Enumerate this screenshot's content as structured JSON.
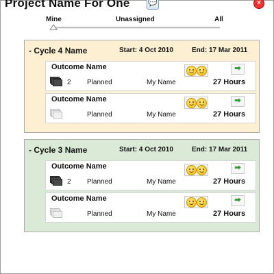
{
  "header": {
    "project_title": "Project Name For One",
    "title_icon": "speech-bubble-icon",
    "close_icon": "close-icon"
  },
  "filter": {
    "options": [
      "Mine",
      "Unassigned",
      "All"
    ],
    "selected": "Mine"
  },
  "cycles": [
    {
      "name": "- Cycle 4 Name",
      "start": "Start: 4 Oct 2010",
      "end": "End: 17 Mar 2011",
      "background": "#fdf0d2",
      "outcomes": [
        {
          "name": "Outcome Name",
          "count": "2",
          "status": "Planned",
          "owner": "My Name",
          "hours": "27 Hours",
          "icon": "dark-stack-icon"
        },
        {
          "name": "Outcome Name",
          "count": "",
          "status": "Planned",
          "owner": "My Name",
          "hours": "27 Hours",
          "icon": "light-stack-icon"
        }
      ]
    },
    {
      "name": "- Cycle 3 Name",
      "start": "Start: 4 Oct 2010",
      "end": "End: 17 Mar 2011",
      "background": "#dbead6",
      "outcomes": [
        {
          "name": "Outcome Name",
          "count": "2",
          "status": "Planned",
          "owner": "My Name",
          "hours": "27 Hours",
          "icon": "dark-stack-icon"
        },
        {
          "name": "Outcome Name",
          "count": "",
          "status": "Planned",
          "owner": "My Name",
          "hours": "27 Hours",
          "icon": "light-stack-icon"
        }
      ]
    }
  ],
  "icons": {
    "smiley": "smiley-icon",
    "go": "green-arrow-icon"
  }
}
